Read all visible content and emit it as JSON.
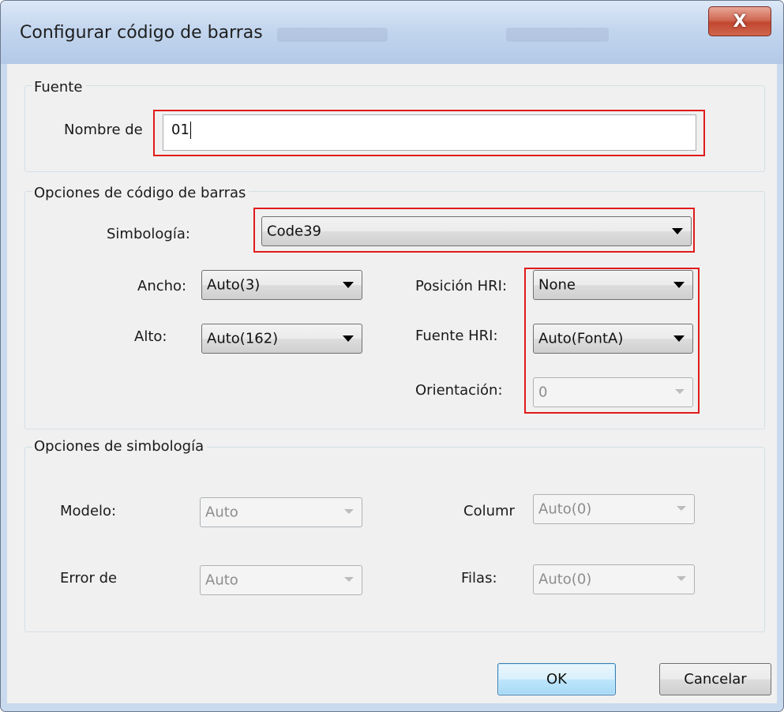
{
  "window": {
    "title": "Configurar código de barras",
    "close_symbol": "X"
  },
  "fuente": {
    "legend": "Fuente",
    "name_label": "Nombre de",
    "name_value": "01"
  },
  "barcode_options": {
    "legend": "Opciones de código de barras",
    "symbology_label": "Simbología:",
    "symbology_value": "Code39",
    "width_label": "Ancho:",
    "width_value": "Auto(3)",
    "height_label": "Alto:",
    "height_value": "Auto(162)",
    "hri_position_label": "Posición HRI:",
    "hri_position_value": "None",
    "hri_font_label": "Fuente HRI:",
    "hri_font_value": "Auto(FontA)",
    "orientation_label": "Orientación:",
    "orientation_value": "0"
  },
  "symbology_options": {
    "legend": "Opciones de simbología",
    "model_label": "Modelo:",
    "model_value": "Auto",
    "error_label": "Error de",
    "error_value": "Auto",
    "columns_label": "Columr",
    "columns_value": "Auto(0)",
    "rows_label": "Filas:",
    "rows_value": "Auto(0)"
  },
  "buttons": {
    "ok": "OK",
    "cancel": "Cancelar"
  },
  "colors": {
    "highlight": "#e11a1a",
    "window_frame": "#c9d9ee",
    "client_bg": "#f0f0f0"
  }
}
